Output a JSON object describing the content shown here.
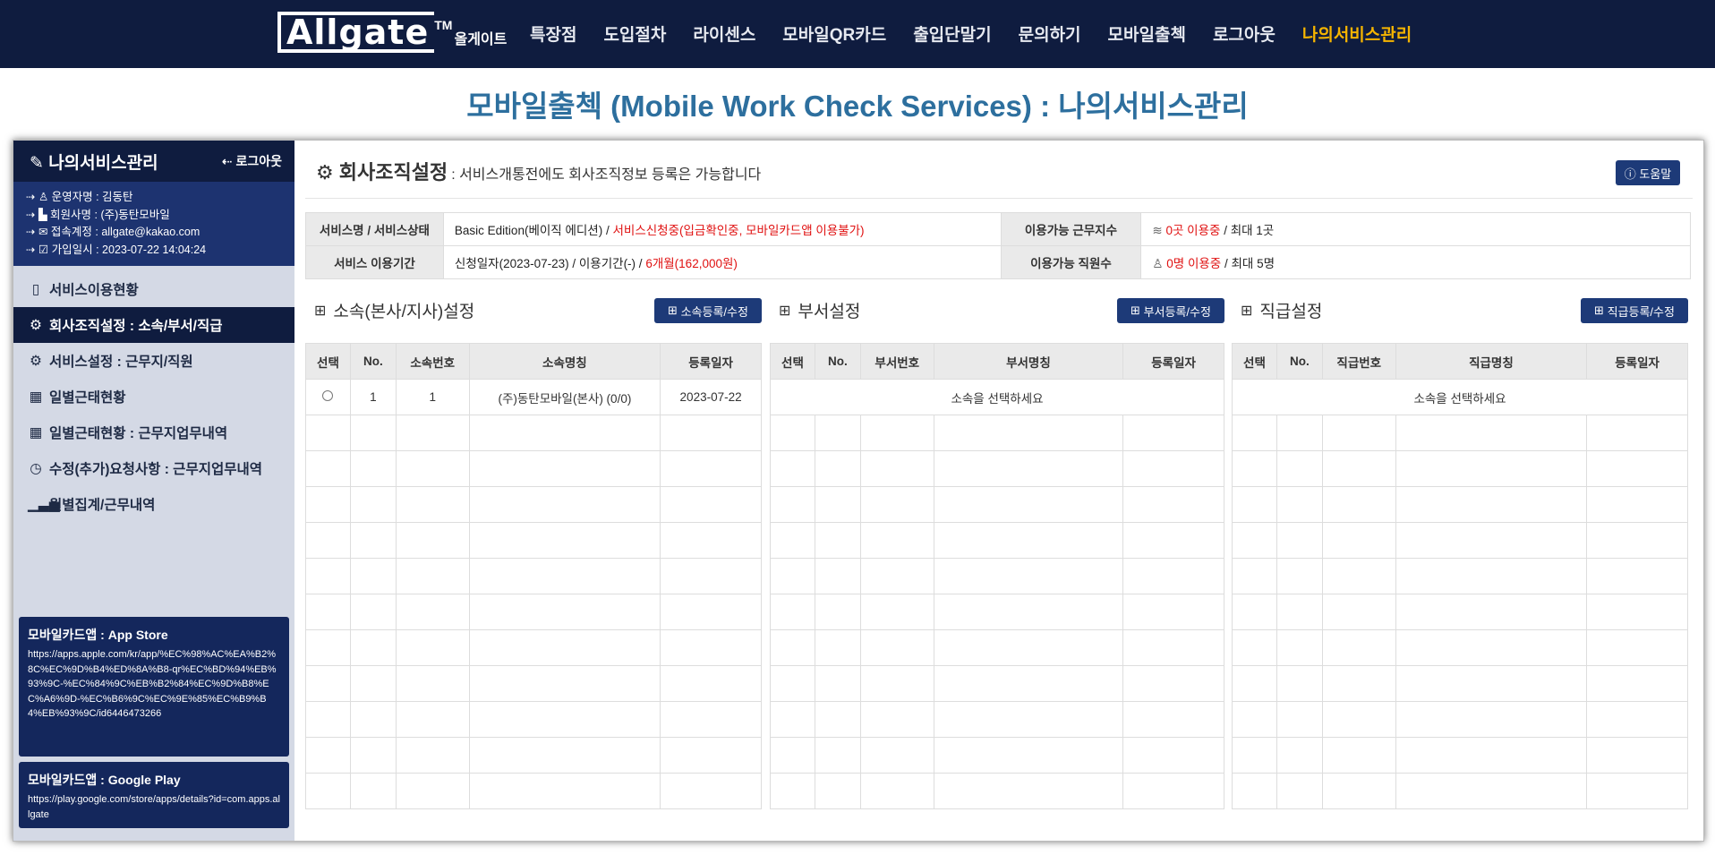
{
  "nav": {
    "logo_main": "Allgate",
    "logo_tm": "TM",
    "logo_ko": "올게이트",
    "links": [
      "특장점",
      "도입절차",
      "라이센스",
      "모바일QR카드",
      "출입단말기",
      "문의하기",
      "모바일출첵",
      "로그아웃",
      "나의서비스관리"
    ],
    "active_color": "#f5b400"
  },
  "page_title": "모바일출첵 (Mobile Work Check Services) : 나의서비스관리",
  "sidebar": {
    "title": "나의서비스관리",
    "logout": "로그아웃",
    "info": [
      "운영자명 : 김동탄",
      "회원사명 : (주)동탄모바일",
      "접속계정 : allgate@kakao.com",
      "가입일시 : 2023-07-22 14:04:24"
    ],
    "menu": [
      "서비스이용현황",
      "회사조직설정 : 소속/부서/직급",
      "서비스설정 : 근무지/직원",
      "일별근태현황",
      "일별근태현황 : 근무지업무내역",
      "수정(추가)요청사항 : 근무지업무내역",
      "월별집계/근무내역"
    ],
    "app_store": {
      "title": "모바일카드앱 : App Store",
      "url": "https://apps.apple.com/kr/app/%EC%98%AC%EA%B2%8C%EC%9D%B4%ED%8A%B8-qr%EC%BD%94%EB%93%9C-%EC%84%9C%EB%B2%84%EC%9D%B8%EC%A6%9D-%EC%B6%9C%EC%9E%85%EC%B9%B4%EB%93%9C/id6446473266"
    },
    "google_play": {
      "title": "모바일카드앱 : Google Play",
      "url": "https://play.google.com/store/apps/details?id=com.apps.allgate"
    }
  },
  "content": {
    "title": "회사조직설정",
    "subtitle": ": 서비스개통전에도 회사조직정보 등록은 가능합니다",
    "help": "도움말",
    "service": {
      "label_name": "서비스명 / 서비스상태",
      "edition": "Basic Edition(베이직 에디션) /",
      "status": "서비스신청중(입금확인중, 모바일카드앱 이용불가)",
      "label_sites": "이용가능 근무지수",
      "sites_used": "0곳 이용중",
      "sites_max": "/ 최대 1곳",
      "label_period": "서비스 이용기간",
      "period": "신청일자(2023-07-23) / 이용기간(-) /",
      "period_len": "6개월(162,000원)",
      "label_staff": "이용가능 직원수",
      "staff_used": "0명 이용중",
      "staff_max": "/ 최대 5명"
    },
    "sections": {
      "affil": {
        "title": "소속(본사/지사)설정",
        "button": "소속등록/수정",
        "headers": [
          "선택",
          "No.",
          "소속번호",
          "소속명칭",
          "등록일자"
        ],
        "row": {
          "no": "1",
          "code": "1",
          "name": "(주)동탄모바일(본사) (0/0)",
          "date": "2023-07-22"
        }
      },
      "dept": {
        "title": "부서설정",
        "button": "부서등록/수정",
        "headers": [
          "선택",
          "No.",
          "부서번호",
          "부서명칭",
          "등록일자"
        ],
        "empty": "소속을 선택하세요"
      },
      "rank": {
        "title": "직급설정",
        "button": "직급등록/수정",
        "headers": [
          "선택",
          "No.",
          "직급번호",
          "직급명칭",
          "등록일자"
        ],
        "empty": "소속을 선택하세요"
      }
    }
  }
}
